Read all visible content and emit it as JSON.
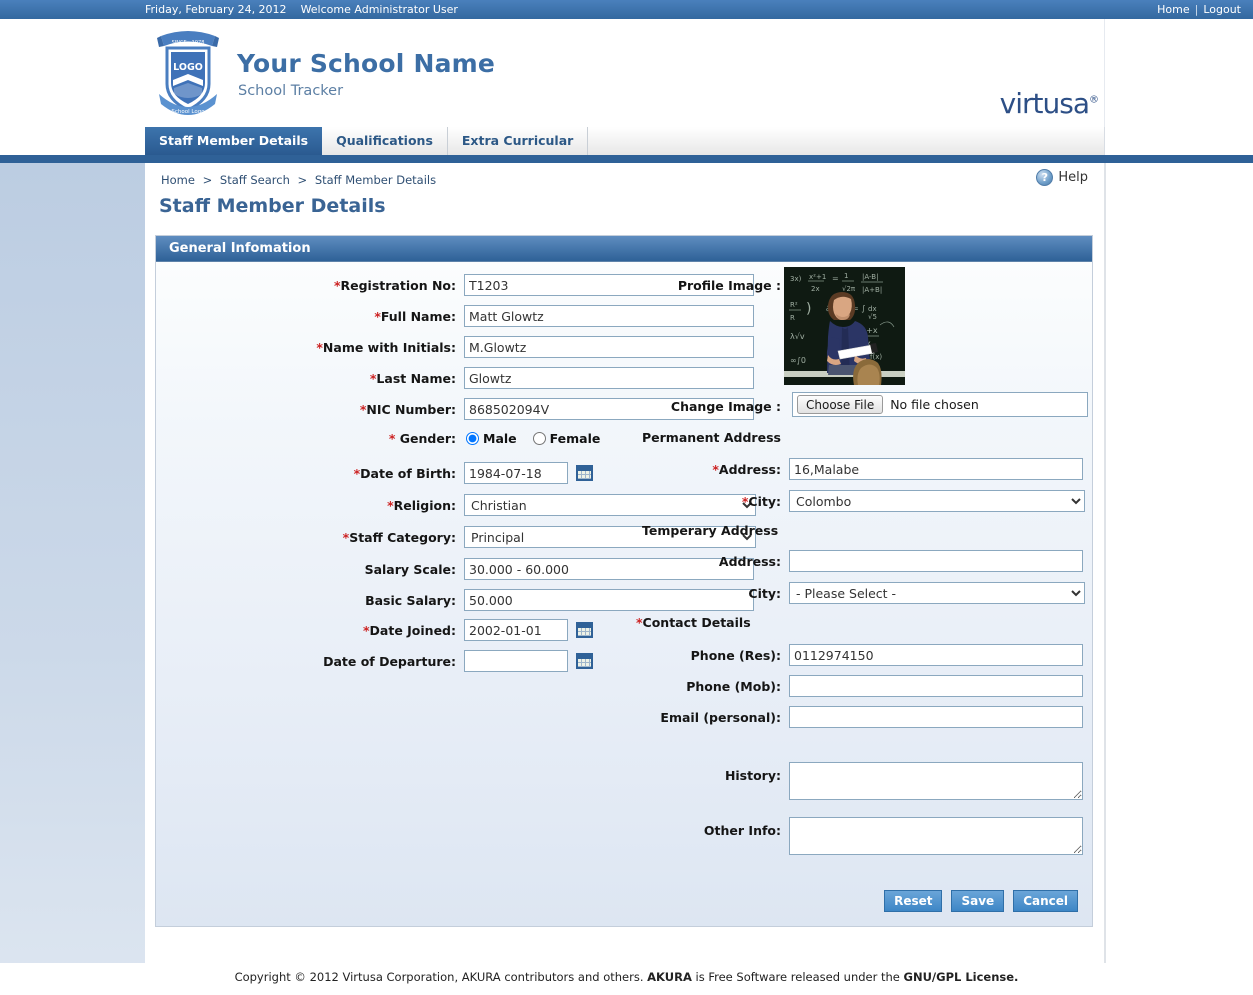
{
  "topbar": {
    "date": "Friday, February 24, 2012",
    "welcome": "Welcome Administrator User",
    "home_link": "Home",
    "separator": "|",
    "logout_link": "Logout"
  },
  "masthead": {
    "logo_text": "LOGO",
    "logo_ribbon_top": "SINCE - 1978",
    "logo_ribbon_bottom": "School Logo",
    "school_name": "Your School Name",
    "tagline": "School Tracker",
    "brand": "virtusa"
  },
  "tabs": [
    {
      "label": "Staff Member Details",
      "active": true
    },
    {
      "label": "Qualifications",
      "active": false
    },
    {
      "label": "Extra Curricular",
      "active": false
    }
  ],
  "breadcrumb": {
    "item1": "Home",
    "item2": "Staff Search",
    "item3": "Staff Member Details",
    "sep": ">"
  },
  "help": {
    "label": "Help",
    "icon": "question-mark-icon",
    "glyph": "?"
  },
  "page_title": "Staff Member Details",
  "section": {
    "header": "General Infomation"
  },
  "left_form": {
    "registration_no": {
      "label": "Registration No:",
      "required": true,
      "value": "T1203"
    },
    "full_name": {
      "label": "Full Name:",
      "required": true,
      "value": "Matt Glowtz"
    },
    "name_initials": {
      "label": "Name with Initials:",
      "required": true,
      "value": "M.Glowtz"
    },
    "last_name": {
      "label": "Last Name:",
      "required": true,
      "value": "Glowtz"
    },
    "nic_number": {
      "label": "NIC Number:",
      "required": true,
      "value": "868502094V"
    },
    "gender": {
      "label": "Gender:",
      "required": true,
      "male": "Male",
      "female": "Female",
      "selected": "Male"
    },
    "date_of_birth": {
      "label": "Date of Birth:",
      "required": true,
      "value": "1984-07-18",
      "icon": "calendar-icon"
    },
    "religion": {
      "label": "Religion:",
      "required": true,
      "value": "Christian"
    },
    "staff_category": {
      "label": "Staff Category:",
      "required": true,
      "value": "Principal"
    },
    "salary_scale": {
      "label": "Salary Scale:",
      "required": false,
      "value": "30.000 - 60.000"
    },
    "basic_salary": {
      "label": "Basic Salary:",
      "required": false,
      "value": "50.000"
    },
    "date_joined": {
      "label": "Date Joined:",
      "required": true,
      "value": "2002-01-01",
      "icon": "calendar-icon"
    },
    "date_departure": {
      "label": "Date of Departure:",
      "required": false,
      "value": "",
      "icon": "calendar-icon"
    }
  },
  "right_form": {
    "profile_image": {
      "label": "Profile Image :"
    },
    "change_image": {
      "label": "Change Image :",
      "button": "Choose File",
      "status": "No file chosen"
    },
    "permanent_address_head": "Permanent Address",
    "perm_address": {
      "label": "Address:",
      "required": true,
      "value": "16,Malabe"
    },
    "perm_city": {
      "label": "City:",
      "required": true,
      "value": "Colombo"
    },
    "temporary_address_head": "Temperary Address",
    "temp_address": {
      "label": "Address:",
      "required": false,
      "value": ""
    },
    "temp_city": {
      "label": "City:",
      "required": false,
      "value": "- Please Select -"
    },
    "contact_details_head": "Contact Details",
    "phone_res": {
      "label": "Phone (Res):",
      "value": "0112974150"
    },
    "phone_mob": {
      "label": "Phone (Mob):",
      "value": ""
    },
    "email_personal": {
      "label": "Email (personal):",
      "value": ""
    },
    "history": {
      "label": "History:",
      "value": ""
    },
    "other_info": {
      "label": "Other Info:",
      "value": ""
    }
  },
  "buttons": {
    "reset": "Reset",
    "save": "Save",
    "cancel": "Cancel"
  },
  "footer": {
    "part1": "Copyright © 2012 Virtusa Corporation, AKURA contributors and others.",
    "bold1": "AKURA",
    "part2": "is Free Software released under the",
    "bold2": "GNU/GPL License."
  },
  "colors": {
    "topbar_blue": "#3a70ad",
    "tab_active": "#2f6299",
    "section_header": "#2e6197",
    "title_blue": "#3a6494",
    "required_red": "#cc2222",
    "button_blue": "#3d86c6",
    "rail_blue": "#ccd9e9"
  }
}
